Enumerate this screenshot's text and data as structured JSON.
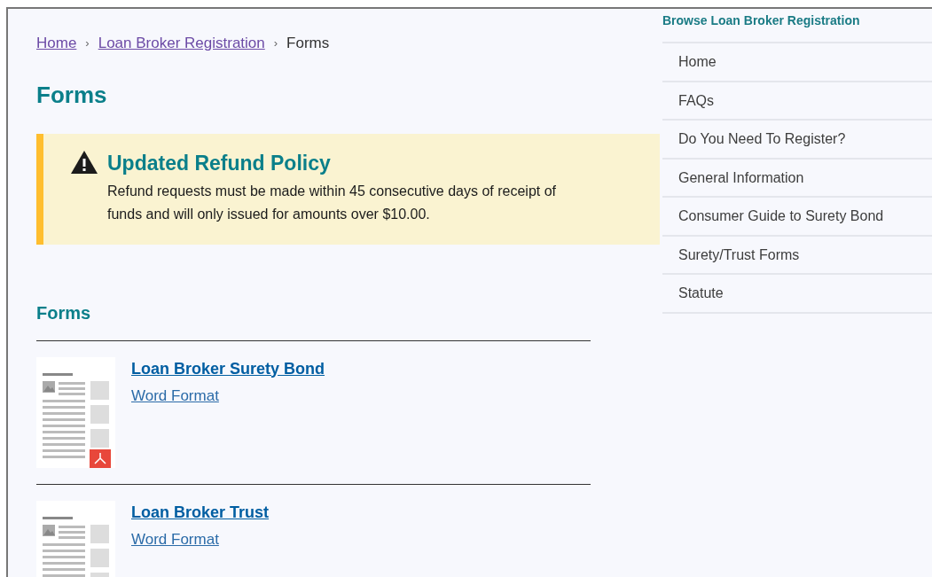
{
  "breadcrumb": [
    {
      "label": "Home",
      "link": true
    },
    {
      "label": "Loan Broker Registration",
      "link": true
    },
    {
      "label": "Forms",
      "link": false
    }
  ],
  "breadcrumb_separator": "›",
  "page_title": "Forms",
  "alert": {
    "title": "Updated Refund Policy",
    "text": "Refund requests must be made within 45 consecutive days of receipt of funds and will only issued for amounts over $10.00."
  },
  "section_title": "Forms",
  "forms": [
    {
      "title": "Loan Broker Surety Bond",
      "format": "Word Format",
      "pdf_badge": true
    },
    {
      "title": "Loan Broker Trust",
      "format": "Word Format"
    }
  ],
  "sidebar": {
    "title": "Browse Loan Broker Registration",
    "items": [
      "Home",
      "FAQs",
      "Do You Need To Register?",
      "General Information",
      "Consumer Guide to Surety Bond",
      "Surety/Trust Forms",
      "Statute"
    ]
  }
}
